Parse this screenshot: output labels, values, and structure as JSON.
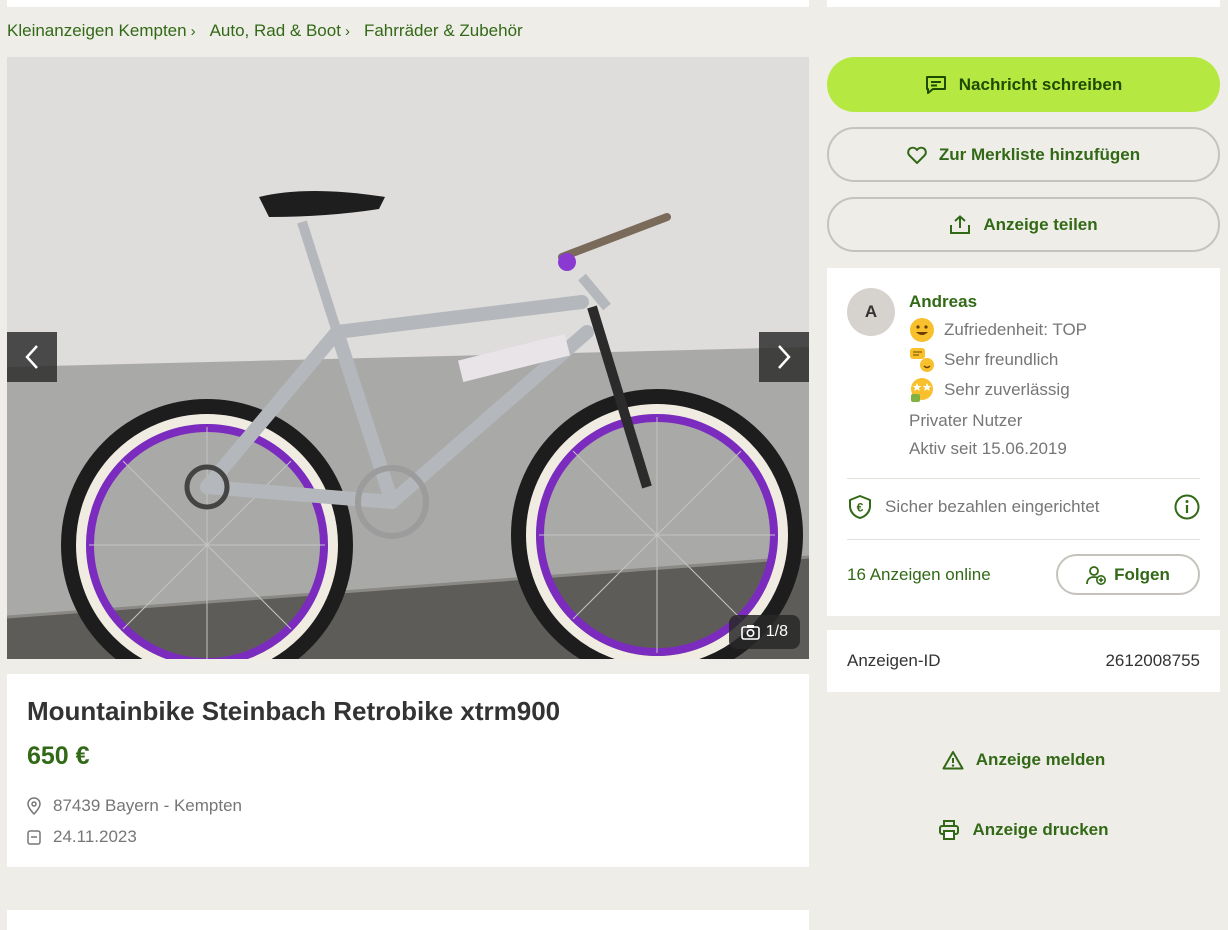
{
  "breadcrumb": [
    "Kleinanzeigen Kempten",
    "Auto, Rad & Boot",
    "Fahrräder & Zubehör"
  ],
  "gallery": {
    "counter": "1/8",
    "current_image": 1,
    "total_images": 8
  },
  "listing": {
    "title": "Mountainbike Steinbach Retrobike xtrm900",
    "price": "650 €",
    "location": "87439 Bayern - Kempten",
    "date": "24.11.2023"
  },
  "actions": {
    "message": "Nachricht schreiben",
    "watchlist": "Zur Merkliste hinzufügen",
    "share": "Anzeige teilen",
    "report": "Anzeige melden",
    "print": "Anzeige drucken"
  },
  "seller": {
    "initial": "A",
    "name": "Andreas",
    "badges": [
      "Zufriedenheit: TOP",
      "Sehr freundlich",
      "Sehr zuverlässig"
    ],
    "type": "Privater Nutzer",
    "active_since": "Aktiv seit 15.06.2019",
    "secure_payment": "Sicher bezahlen eingerichtet",
    "ads_online": "16 Anzeigen online",
    "follow_label": "Folgen"
  },
  "ad_id": {
    "label": "Anzeigen-ID",
    "value": "2612008755"
  },
  "colors": {
    "brand_green": "#326916",
    "primary_button": "#b5e941",
    "rim_purple": "#7b2cbf",
    "page_bg": "#efede8"
  },
  "icons": [
    "chevron-right-icon",
    "chevron-left-icon",
    "camera-icon",
    "message-icon",
    "heart-icon",
    "share-icon",
    "location-pin-icon",
    "calendar-icon",
    "shield-euro-icon",
    "info-icon",
    "add-user-icon",
    "warning-icon",
    "printer-icon"
  ]
}
